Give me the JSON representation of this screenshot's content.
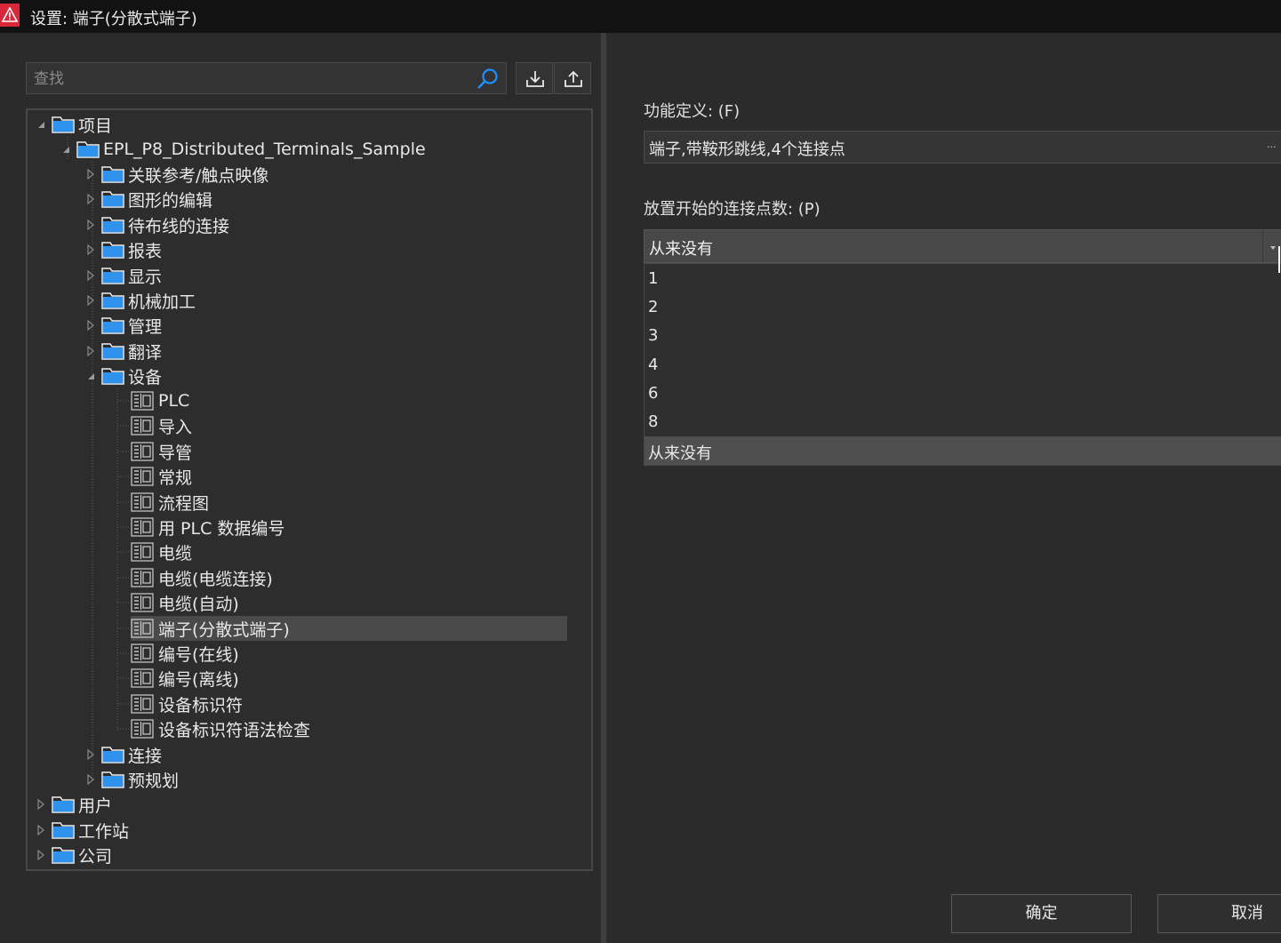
{
  "window": {
    "title": "设置: 端子(分散式端子)"
  },
  "search": {
    "placeholder": "查找"
  },
  "tree": {
    "project": "项目",
    "sample": "EPL_P8_Distributed_Terminals_Sample",
    "groups": [
      "关联参考/触点映像",
      "图形的编辑",
      "待布线的连接",
      "报表",
      "显示",
      "机械加工",
      "管理",
      "翻译"
    ],
    "devices": "设备",
    "device_items": [
      "PLC",
      "导入",
      "导管",
      "常规",
      "流程图",
      "用 PLC 数据编号",
      "电缆",
      "电缆(电缆连接)",
      "电缆(自动)",
      "端子(分散式端子)",
      "编号(在线)",
      "编号(离线)",
      "设备标识符",
      "设备标识符语法检查"
    ],
    "after_groups": [
      "连接",
      "预规划"
    ],
    "roots": [
      "用户",
      "工作站",
      "公司"
    ]
  },
  "form": {
    "function_label": "功能定义: (F)",
    "function_value": "端子,带鞍形跳线,4个连接点",
    "ellipsis": "...",
    "conn_label": "放置开始的连接点数: (P)",
    "conn_value": "从来没有",
    "options": [
      "1",
      "2",
      "3",
      "4",
      "6",
      "8",
      "从来没有"
    ]
  },
  "buttons": {
    "ok": "确定",
    "cancel": "取消"
  },
  "colors": {
    "accent": "#1e8fff",
    "app_icon": "#d8283a",
    "folder": "#2f93ee"
  }
}
